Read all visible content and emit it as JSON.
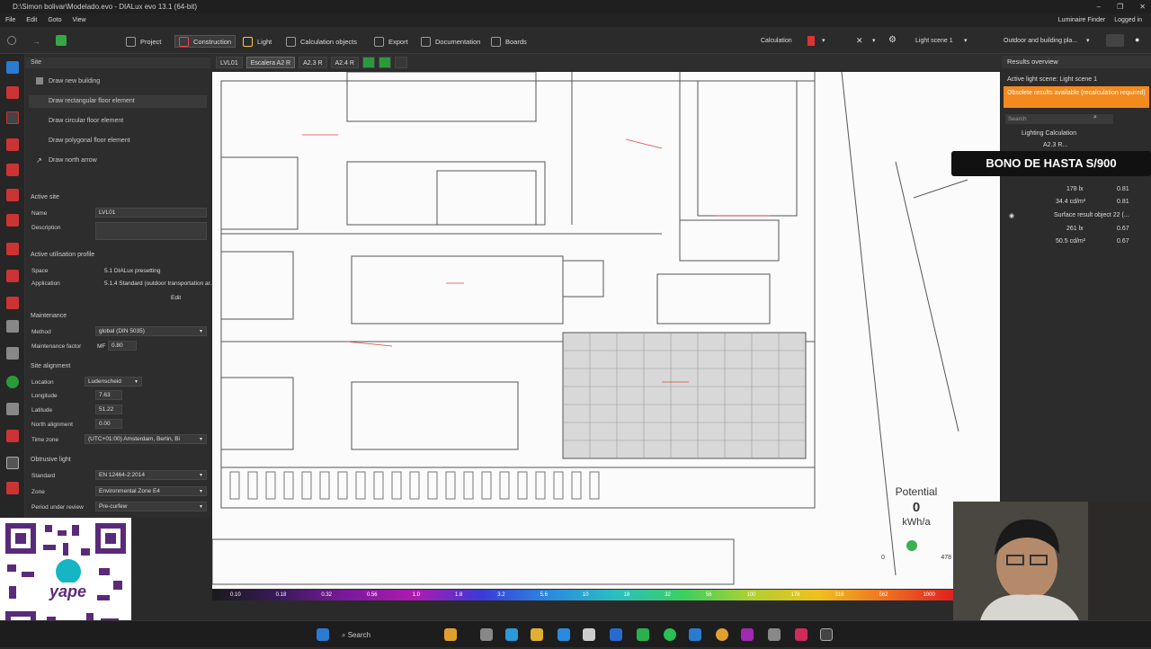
{
  "window": {
    "title": "D:\\Simon bolivar\\Modelado.evo - DIALux evo 13.1 (64-bit)",
    "controls": [
      "–",
      "❐",
      "✕"
    ]
  },
  "menu": {
    "items": [
      "File",
      "Edit",
      "Goto",
      "View"
    ],
    "right": [
      "Luminaire Finder",
      "Logged in"
    ]
  },
  "ribbon": {
    "tabs": [
      "Project",
      "Construction",
      "Light",
      "Calculation objects",
      "Export",
      "Documentation",
      "Boards"
    ],
    "active_tab": "Construction",
    "calculation_label": "Calculation",
    "light_scene": "Light scene 1",
    "view_mode": "Outdoor and building pla..."
  },
  "view_tabs": [
    "LVL01",
    "Escalera A2 R",
    "A2.3 R",
    "A2.4 R"
  ],
  "left_panel": {
    "site_header": "Site",
    "actions": [
      "Draw new building",
      "Draw rectangular floor element",
      "Draw circular floor element",
      "Draw polygonal floor element",
      "Draw north arrow"
    ],
    "active_site_header": "Active site",
    "name_label": "Name",
    "name_value": "LVL01",
    "description_label": "Description",
    "description_value": "",
    "utilisation_header": "Active utilisation profile",
    "space_label": "Space",
    "space_value": "5.1 DIALux presetting",
    "application_label": "Application",
    "application_value": "5.1.4 Standard (outdoor transportation ar...",
    "edit_label": "Edit",
    "maintenance_header": "Maintenance",
    "method_label": "Method",
    "method_value": "global (DIN 5035)",
    "mf_label": "Maintenance factor",
    "mf_prefix": "MF",
    "mf_value": "0.80",
    "alignment_header": "Site alignment",
    "location_label": "Location",
    "location_value": "Ludenscheid",
    "longitude_label": "Longitude",
    "longitude_value": "7.63",
    "latitude_label": "Latitude",
    "latitude_value": "51.22",
    "north_label": "North alignment",
    "north_value": "0.00",
    "timezone_label": "Time zone",
    "timezone_value": "(UTC+01:00) Amsterdam, Berlin, Bi",
    "obtrusive_header": "Obtrusive light",
    "standard_label": "Standard",
    "standard_value": "EN 12464-2:2014",
    "zone_label": "Zone",
    "zone_value": "Environmental Zone E4",
    "period_label": "Period under review",
    "period_value": "Pre-curfew"
  },
  "right_panel": {
    "header": "Results overview",
    "active_scene": "Active light scene: Light scene 1",
    "warning": "Obsolete results available (recalculation required)",
    "search_placeholder": "Search",
    "tree_root": "Lighting Calculation",
    "row1": "A2.3 R...",
    "values": [
      {
        "label": "178 lx",
        "v": "0.81"
      },
      {
        "label": "34.4 cd/m²",
        "v": "0.81"
      },
      {
        "label": "Surface result object 22 (...",
        "v": ""
      },
      {
        "label": "261 lx",
        "v": "0.67"
      },
      {
        "label": "50.5 cd/m²",
        "v": "0.67"
      }
    ]
  },
  "promo": "BONO DE HASTA S/900",
  "potential": {
    "label": "Potential",
    "value": "0",
    "unit": "kWh/a",
    "scale_min": "0",
    "scale_max": "478"
  },
  "colorbar": {
    "ticks": [
      "0.10",
      "0.18",
      "0.32",
      "0.56",
      "1.0",
      "1.8",
      "3.2",
      "5.6",
      "10",
      "18",
      "32",
      "56",
      "100",
      "178",
      "316",
      "562",
      "1000"
    ]
  },
  "qr": {
    "brand": "yape"
  },
  "taskbar": {
    "search": "Search"
  }
}
